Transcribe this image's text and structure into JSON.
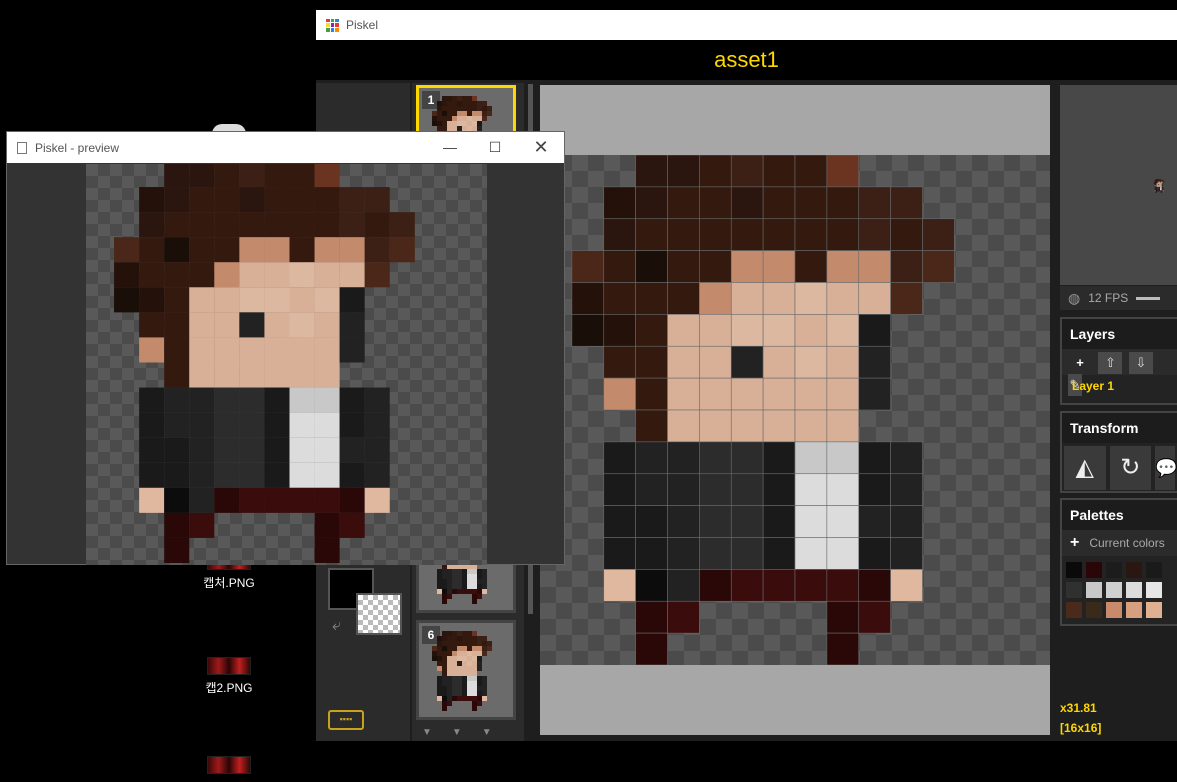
{
  "desktop": {
    "icons": [
      {
        "label": "캡처.PNG"
      },
      {
        "label": "캡2.PNG"
      },
      {
        "label": ""
      }
    ]
  },
  "main_window": {
    "title": "Piskel",
    "document_title": "asset1",
    "frames": [
      {
        "number": "1",
        "selected": true
      },
      {
        "number": "6",
        "selected": false
      }
    ],
    "fps_label": "12 FPS",
    "layers": {
      "title": "Layers",
      "add_icon": "plus-icon",
      "up_icon": "arrow-up-icon",
      "down_icon": "arrow-down-icon",
      "edit_icon": "pencil-icon",
      "items": [
        "Layer 1"
      ]
    },
    "transform": {
      "title": "Transform",
      "tools": [
        "flip-icon",
        "rotate-icon",
        "speech-icon"
      ]
    },
    "palettes": {
      "title": "Palettes",
      "add_icon": "plus-icon",
      "current": "Current colors",
      "swatches": [
        "#0a0a0a",
        "#2a0608",
        "#1c1c1c",
        "#2a1712",
        "#1a1a1a",
        "#303030",
        "#c8c8c8",
        "#d0d0d0",
        "#dcdcdc",
        "#e6e6e6",
        "#4a2a1a",
        "#3a2a1a",
        "#c88a6a",
        "#d6a080",
        "#e0b090"
      ]
    },
    "cursor_coords": "x31.81",
    "canvas_size": "[16x16]",
    "keyboard_icon": "keyboard-icon",
    "swap_icon": "swap-colors-icon",
    "primary_color": "#000000",
    "secondary_color": "transparent"
  },
  "preview_window": {
    "title": "Piskel - preview",
    "minimize_icon": "minimize-icon",
    "maximize_icon": "maximize-icon",
    "close_icon": "close-icon"
  },
  "sprite": {
    "palette": {
      "a": "#2a160e",
      "b": "#34190f",
      "c": "#3c2016",
      "d": "#4a2718",
      "e": "#6a3420",
      "f": "#24120a",
      "g": "#1a0e08",
      "k": "#c48a6c",
      "s": "#d8b098",
      "t": "#ddb8a0",
      "h": "#1a1a1a",
      "j": "#222222",
      "m": "#2c2c2c",
      "w": "#c8c8c8",
      "x": "#dcdcdc",
      "r": "#2a0808",
      "q": "#3a0c0c",
      "n": "#0c0c0c",
      "p": "#e0b8a0"
    },
    "rows": [
      "...aabcbbe......",
      "..fabbabbbcc....",
      "..abbbbbbbcbc...",
      ".dbgbbkkbkkcd...",
      ".fbbbksstssd....",
      ".gfbssttsth.....",
      "..bbssjstsj.....",
      "..kbssssssj.....",
      "...bssssss......",
      "..hjjmmhwwhj....",
      "..hjjmmhxxhj....",
      "..hhjmmhxxjj....",
      "..hhjmmhxxhj....",
      "..pnjrqqqqrp....",
      "...rq....rq.....",
      "...r.....r......"
    ]
  }
}
